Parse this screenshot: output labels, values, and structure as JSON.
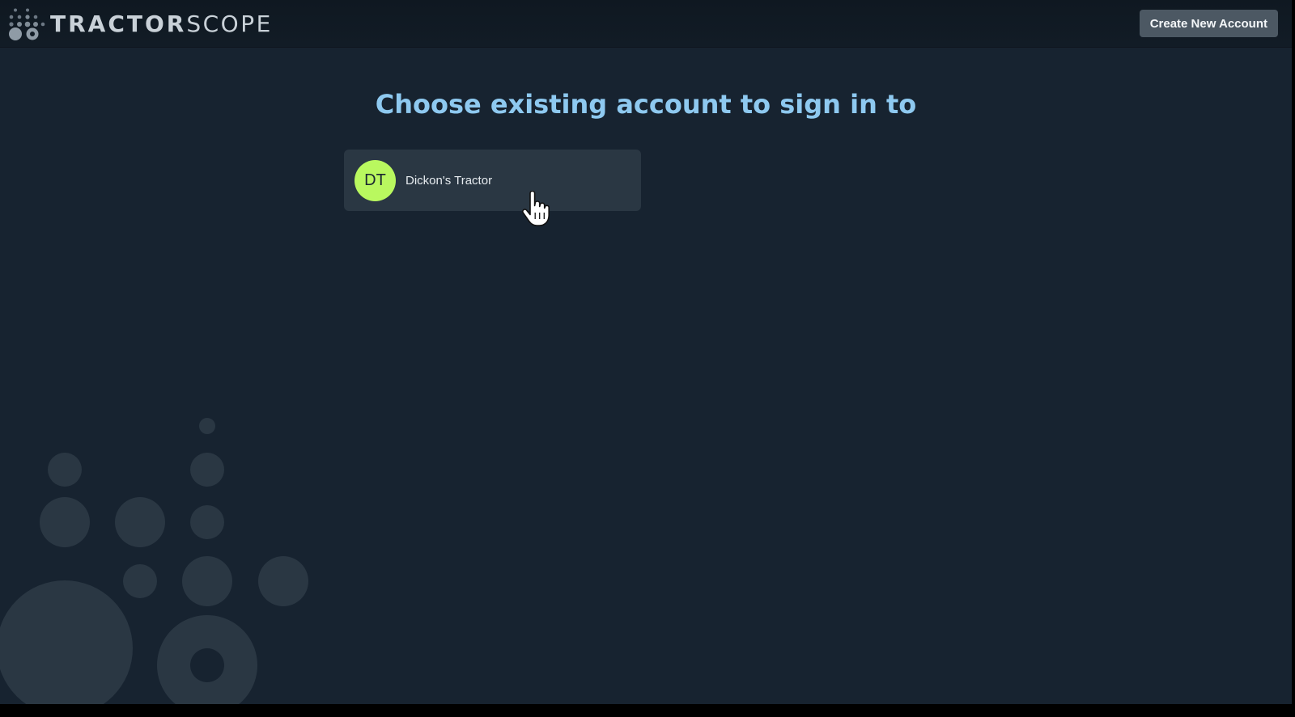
{
  "header": {
    "brand_bold": "TRACTOR",
    "brand_light": "SCOPE",
    "logo_icon": "dots-cluster-icon",
    "create_account_label": "Create New Account"
  },
  "main": {
    "title": "Choose existing account to sign in to",
    "accounts": [
      {
        "initials": "DT",
        "name": "Dickon's Tractor",
        "avatar_color": "#b9f85f"
      }
    ]
  },
  "colors": {
    "background": "#172330",
    "top_bar": "#121c26",
    "title": "#8ec9f0",
    "card": "#2a3743",
    "button": "#4c5863",
    "decoration": "#2a3743"
  },
  "icons": {
    "cursor": "hand-pointer-icon",
    "background": "decorative-circles-icon"
  }
}
